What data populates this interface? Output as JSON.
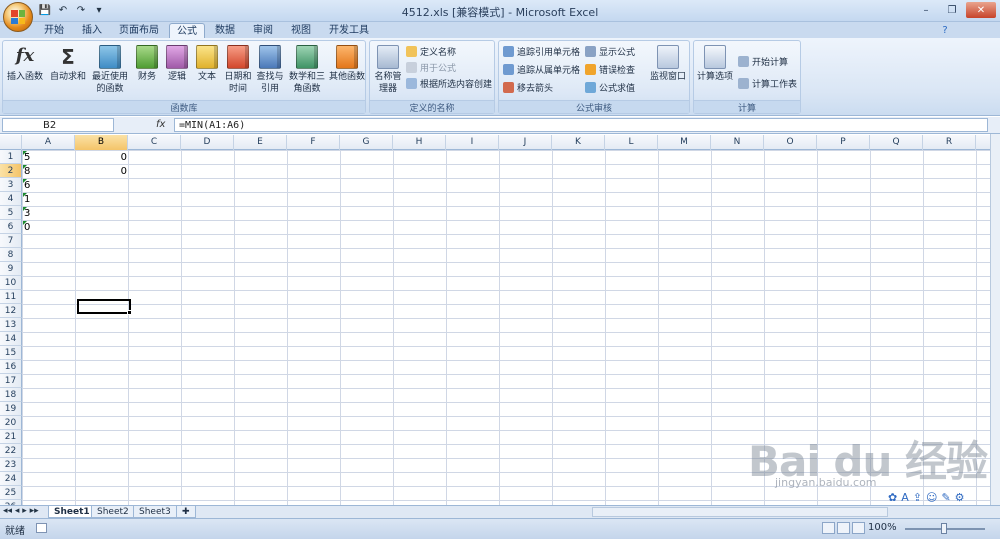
{
  "window": {
    "title": "4512.xls  [兼容模式] - Microsoft Excel",
    "minimize": "–",
    "restore": "❐",
    "close": "✕"
  },
  "qat": {
    "save": "💾",
    "undo": "↶",
    "redo": "↷",
    "preview": "▾"
  },
  "tabs": [
    {
      "label": "开始"
    },
    {
      "label": "插入"
    },
    {
      "label": "页面布局"
    },
    {
      "label": "公式"
    },
    {
      "label": "数据"
    },
    {
      "label": "审阅"
    },
    {
      "label": "视图"
    },
    {
      "label": "开发工具"
    }
  ],
  "ribbon": {
    "function_library": {
      "label": "函数库",
      "insert_function": "插入函数",
      "autosum": "自动求和",
      "recent": "最近使用的函数",
      "financial": "财务",
      "logical": "逻辑",
      "text": "文本",
      "datetime": "日期和时间",
      "lookup": "查找与引用",
      "math": "数学和三角函数",
      "more": "其他函数"
    },
    "defined_names": {
      "label": "定义的名称",
      "name_manager": "名称管理器",
      "define_name": "定义名称",
      "use_in_formula": "用于公式",
      "create_from_selection": "根据所选内容创建"
    },
    "formula_auditing": {
      "label": "公式审核",
      "trace_precedents": "追踪引用单元格",
      "trace_dependents": "追踪从属单元格",
      "remove_arrows": "移去箭头",
      "show_formulas": "显示公式",
      "error_checking": "错误检查",
      "evaluate_formula": "公式求值",
      "watch_window": "监视窗口"
    },
    "calculation": {
      "label": "计算",
      "options": "计算选项",
      "calc_now": "开始计算",
      "calc_sheet": "计算工作表"
    }
  },
  "formula_bar": {
    "name_box": "B2",
    "fx": "fx",
    "formula": "=MIN(A1:A6)"
  },
  "columns": [
    "A",
    "B",
    "C",
    "D",
    "E",
    "F",
    "G",
    "H",
    "I",
    "J",
    "K",
    "L",
    "M",
    "N",
    "O",
    "P",
    "Q",
    "R"
  ],
  "rows": [
    "1",
    "2",
    "3",
    "4",
    "5",
    "6",
    "7",
    "8",
    "9",
    "10",
    "11",
    "12",
    "13",
    "14",
    "15",
    "16",
    "17",
    "18",
    "19",
    "20",
    "21",
    "22",
    "23",
    "24",
    "25",
    "26"
  ],
  "cells": {
    "A1": "5",
    "A2": "8",
    "A3": "6",
    "A4": "1",
    "A5": "3",
    "A6": "0",
    "B1": "0",
    "B2": "0"
  },
  "sheets": [
    "Sheet1",
    "Sheet2",
    "Sheet3"
  ],
  "status": {
    "ready": "就绪",
    "zoom": "100%"
  },
  "watermark": {
    "brand": "Bai du 经验",
    "url": "jingyan.baidu.com"
  },
  "colors": {
    "accent": "#f4c469",
    "ribbon": "#dae6f5",
    "grid_line": "#d0d7e5"
  }
}
